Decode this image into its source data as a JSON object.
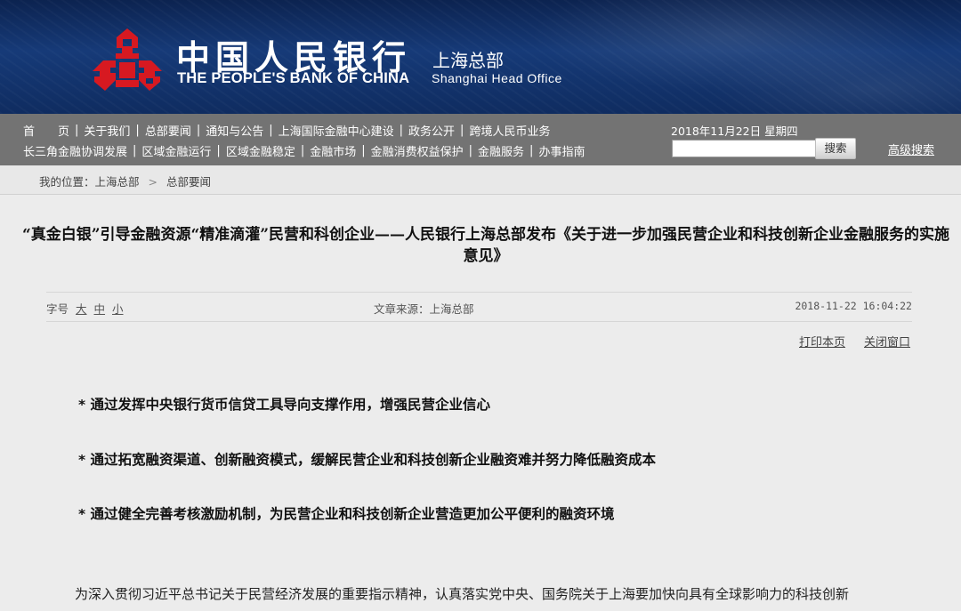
{
  "header": {
    "bank_name_cn": "中国人民银行",
    "bank_name_en": "THE PEOPLE'S BANK OF CHINA",
    "office_cn": "上海总部",
    "office_en": "Shanghai Head Office",
    "logo_icon": "pboc-emblem-icon",
    "colors": {
      "banner": "#163a78",
      "emblem": "#d71921"
    }
  },
  "nav": {
    "row1": [
      "首　　页",
      "关于我们",
      "总部要闻",
      "通知与公告",
      "上海国际金融中心建设",
      "政务公开",
      "跨境人民币业务"
    ],
    "row2": [
      "长三角金融协调发展",
      "区域金融运行",
      "区域金融稳定",
      "金融市场",
      "金融消费权益保护",
      "金融服务",
      "办事指南"
    ],
    "separator": "|"
  },
  "toolbar": {
    "date": "2018年11月22日",
    "weekday": "星期四",
    "search_value": "",
    "search_button": "搜索",
    "advanced_search": "高级搜索"
  },
  "breadcrumb": {
    "prefix": "我的位置：",
    "items": [
      "上海总部",
      "总部要闻"
    ],
    "arrow": ">"
  },
  "article": {
    "title": "“真金白银”引导金融资源“精准滴灌”民营和科创企业——人民银行上海总部发布《关于进一步加强民营企业和科技创新企业金融服务的实施意见》",
    "font_size_label": "字号",
    "font_sizes": [
      "大",
      "中",
      "小"
    ],
    "source": "文章来源：上海总部",
    "timestamp": "2018-11-22 16:04:22",
    "print": "打印本页",
    "close": "关闭窗口",
    "highlights": [
      "* 通过发挥中央银行货币信贷工具导向支撑作用，增强民营企业信心",
      "* 通过拓宽融资渠道、创新融资模式，缓解民营企业和科技创新企业融资难并努力降低融资成本",
      "* 通过健全完善考核激励机制，为民营企业和科技创新企业营造更加公平便利的融资环境"
    ],
    "body_start": "为深入贯彻习近平总书记关于民营经济发展的重要指示精神，认真落实党中央、国务院关于上海要加快向具有全球影响力的科技创新"
  }
}
